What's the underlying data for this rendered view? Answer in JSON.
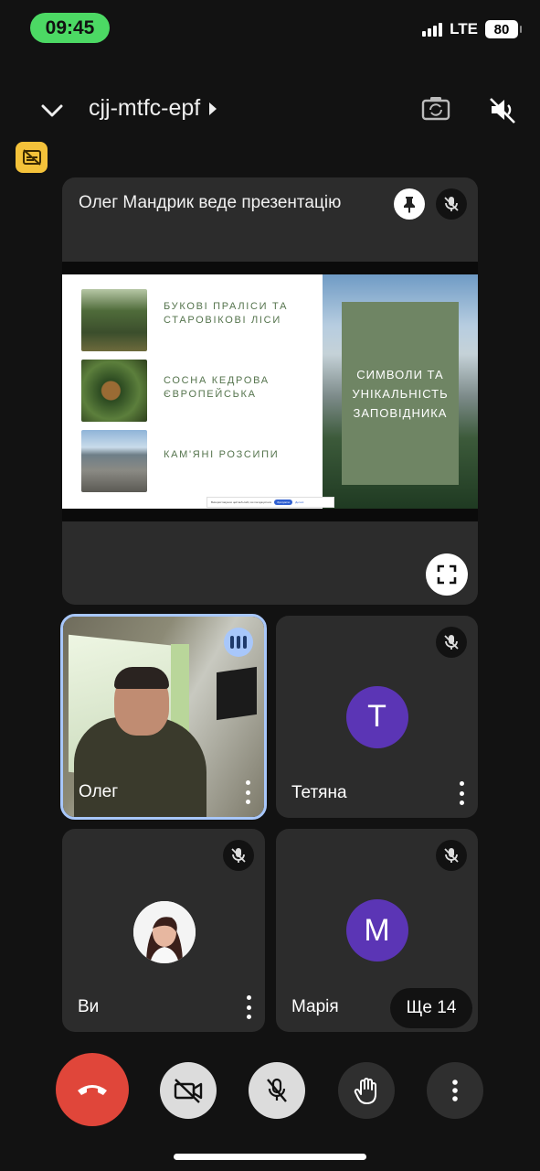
{
  "status_bar": {
    "time": "09:45",
    "network": "LTE",
    "battery": "80"
  },
  "header": {
    "meeting_code": "cjj-mtfc-epf"
  },
  "presentation": {
    "title": "Олег Мандрик веде презентацію",
    "slide": {
      "items": [
        "БУКОВІ ПРАЛІСИ ТА СТАРОВІКОВІ ЛІСИ",
        "СОСНА КЕДРОВА ЄВРОПЕЙСЬКА",
        "КАМ'ЯНІ РОЗСИПИ"
      ],
      "panel_lines": [
        "СИМВОЛИ ТА",
        "УНІКАЛЬНІСТЬ",
        "ЗАПОВІДНИКА"
      ],
      "cookie_text": "Використовуючи цей веб-сайт, ви погоджуєтеся",
      "cookie_button": "Зрозуміло",
      "cookie_link": "Деталі"
    }
  },
  "participants": [
    {
      "name": "Олег",
      "type": "video"
    },
    {
      "name": "Тетяна",
      "initial": "T"
    },
    {
      "name": "Ви",
      "type": "photo"
    },
    {
      "name": "Марія",
      "initial": "M"
    }
  ],
  "more_participants": "Ще 14",
  "colors": {
    "accent": "#a8c7fa",
    "end_call": "#e0463a",
    "avatar": "#5b35b5",
    "captions_badge": "#f4c23a"
  }
}
